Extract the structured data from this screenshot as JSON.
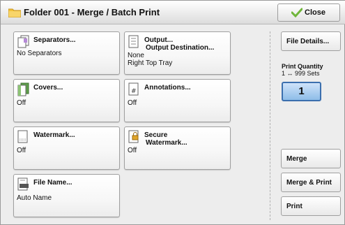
{
  "header": {
    "title": "Folder 001 - Merge / Batch Print",
    "close_label": "Close"
  },
  "tiles": [
    {
      "id": "separators",
      "name": "Separators...",
      "value": "No Separators"
    },
    {
      "id": "output",
      "name_line1": "Output...",
      "name_line2": "Output Destination...",
      "value_line1": "None",
      "value_line2": "Right Top Tray"
    },
    {
      "id": "covers",
      "name": "Covers...",
      "value": "Off"
    },
    {
      "id": "annotations",
      "name": "Annotations...",
      "value": "Off"
    },
    {
      "id": "watermark",
      "name": "Watermark...",
      "value": "Off"
    },
    {
      "id": "secure-watermark",
      "name_line1": "Secure",
      "name_line2": "Watermark...",
      "value": "Off"
    },
    {
      "id": "file-name",
      "name": "File Name...",
      "value": "Auto Name"
    }
  ],
  "side": {
    "file_details_label": "File Details...",
    "print_quantity_title": "Print Quantity",
    "print_quantity_range": "1 ↔ 999 Sets",
    "print_quantity_value": "1",
    "merge_label": "Merge",
    "merge_print_label": "Merge & Print",
    "print_label": "Print"
  },
  "colors": {
    "accent_blue": "#3b6fae",
    "folder_yellow": "#f2c23a",
    "check_green": "#6fb53a"
  },
  "icons": {
    "title": "folder-icon",
    "close": "checkmark-icon",
    "separators": "separator-sheets-icon",
    "output": "output-tray-icon",
    "covers": "covers-icon",
    "annotations": "annotation-icon",
    "watermark": "watermark-icon",
    "secure_watermark": "secure-watermark-icon",
    "file_name": "file-name-icon"
  }
}
